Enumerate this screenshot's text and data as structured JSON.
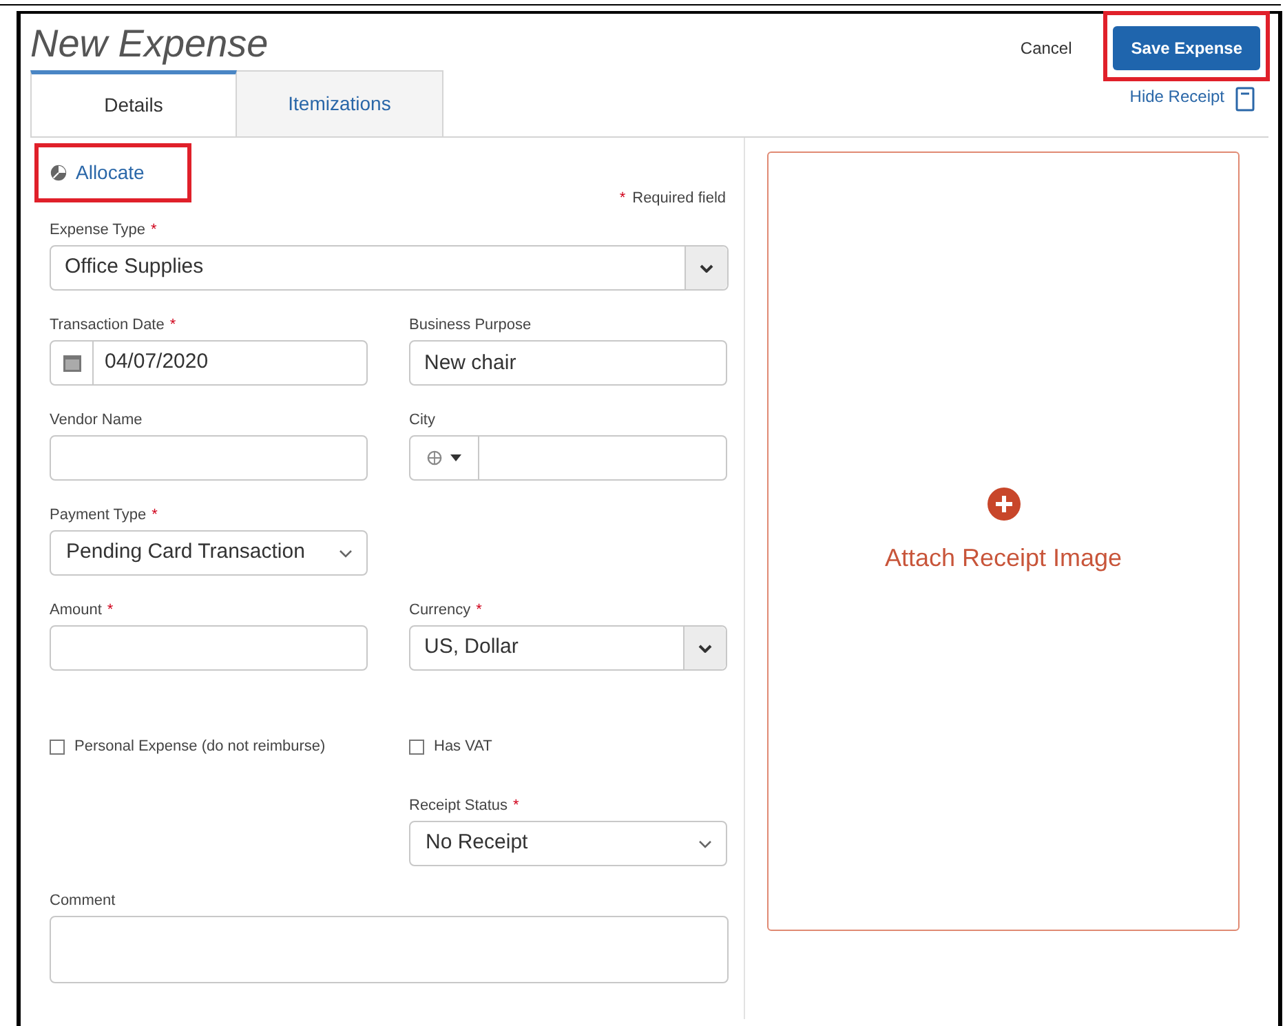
{
  "header": {
    "title": "New Expense",
    "cancel": "Cancel",
    "save": {
      "label": "Save Expense",
      "highlighted": true
    }
  },
  "tabs": [
    {
      "label": "Details",
      "selected": true
    },
    {
      "label": "Itemizations",
      "selected": false
    }
  ],
  "hide_receipt": "Hide Receipt",
  "allocate": {
    "label": "Allocate",
    "highlighted": true
  },
  "required_note": {
    "marker": "*",
    "text": "Required field"
  },
  "rows": [
    [
      {
        "kind": "dropdown",
        "label": "Expense Type",
        "marker": "*",
        "value": "Office Supplies"
      }
    ],
    [
      {
        "kind": "date",
        "label": "Transaction Date",
        "marker": "*",
        "value": "04/07/2020"
      },
      {
        "kind": "text",
        "label": "Business Purpose",
        "value": "New chair"
      }
    ],
    [
      {
        "kind": "text",
        "label": "Vendor Name"
      },
      {
        "kind": "city",
        "label": "City"
      }
    ],
    [
      {
        "kind": "select",
        "label": "Payment Type",
        "marker": "*",
        "value": "Pending Card Transaction"
      }
    ],
    [
      {
        "kind": "text",
        "label": "Amount",
        "marker": "*"
      },
      {
        "kind": "dropdown",
        "label": "Currency",
        "marker": "*",
        "value": "US, Dollar"
      }
    ],
    [
      {
        "kind": "checkbox",
        "label": "Personal Expense (do not reimburse)",
        "checked": false
      },
      {
        "kind": "checkbox",
        "label": "Has VAT",
        "checked": false
      }
    ],
    [
      {
        "kind": "empty"
      },
      {
        "kind": "select",
        "label": "Receipt Status",
        "marker": "*",
        "value": "No Receipt"
      }
    ],
    [
      {
        "kind": "textarea",
        "label": "Comment"
      }
    ]
  ],
  "receipt": {
    "label": "Attach Receipt Image"
  }
}
